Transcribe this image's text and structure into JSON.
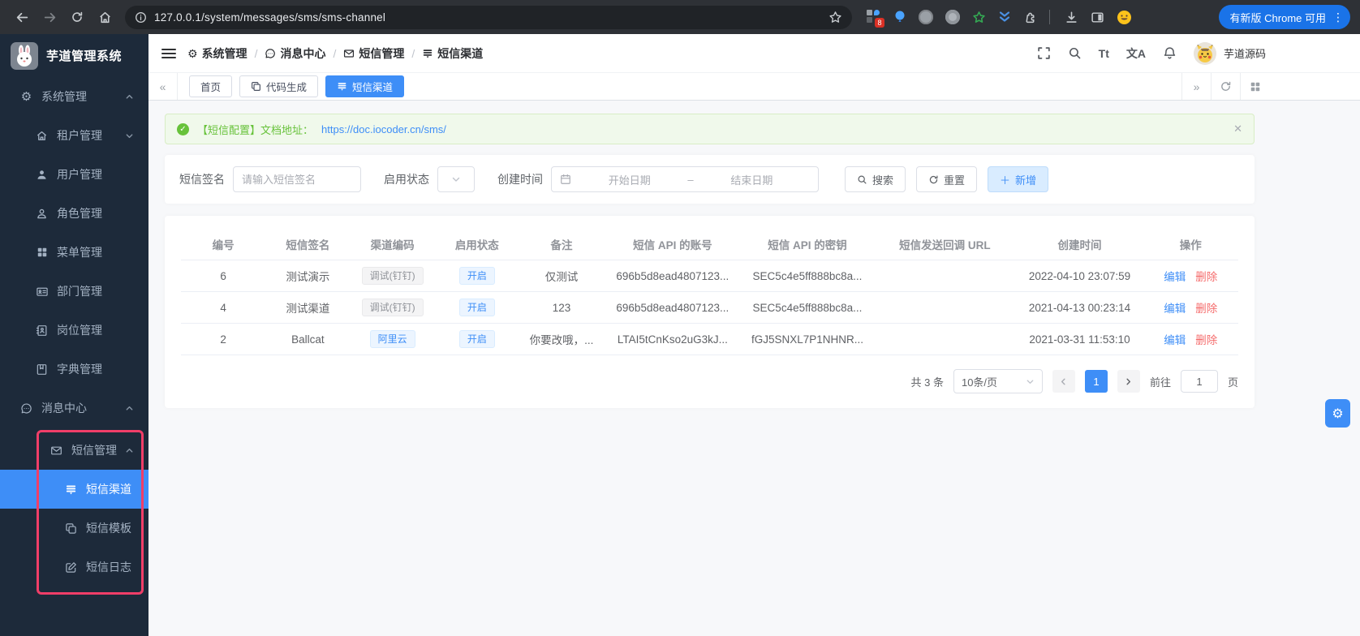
{
  "colors": {
    "accent": "#3e8ef7",
    "sidebar_bg": "#1d2a3a",
    "highlight_box": "#f03e68",
    "success": "#67c23a",
    "danger": "#f56c6c",
    "chrome_update_pill": "#1a73e8"
  },
  "icons": {
    "gear": "⚙",
    "collapse_tabs": "«",
    "expand_tabs": "»",
    "close": "✕",
    "plus": "＋",
    "kebab": "⋮",
    "font_size": "Tt",
    "language": "文A"
  },
  "browser": {
    "url": "127.0.0.1/system/messages/sms/sms-channel",
    "update_button": "有新版 Chrome 可用",
    "extension_badge": "8"
  },
  "app_title": "芋道管理系统",
  "topbar": {
    "breadcrumb": [
      {
        "label": "系统管理"
      },
      {
        "label": "消息中心"
      },
      {
        "label": "短信管理"
      },
      {
        "label": "短信渠道"
      }
    ],
    "username": "芋道源码"
  },
  "tabs": {
    "items": [
      {
        "label": "首页"
      },
      {
        "label": "代码生成"
      },
      {
        "label": "短信渠道"
      }
    ]
  },
  "sidebar": {
    "items": [
      {
        "label": "系统管理"
      },
      {
        "label": "租户管理"
      },
      {
        "label": "用户管理"
      },
      {
        "label": "角色管理"
      },
      {
        "label": "菜单管理"
      },
      {
        "label": "部门管理"
      },
      {
        "label": "岗位管理"
      },
      {
        "label": "字典管理"
      },
      {
        "label": "消息中心"
      },
      {
        "label": "短信管理"
      },
      {
        "label": "短信渠道"
      },
      {
        "label": "短信模板"
      },
      {
        "label": "短信日志"
      }
    ]
  },
  "alert": {
    "text": "【短信配置】文档地址：",
    "link": "https://doc.iocoder.cn/sms/"
  },
  "filters": {
    "signature_label": "短信签名",
    "signature_placeholder": "请输入短信签名",
    "status_label": "启用状态",
    "date_label": "创建时间",
    "start_placeholder": "开始日期",
    "range_separator": "–",
    "end_placeholder": "结束日期",
    "search_button": "搜索",
    "reset_button": "重置",
    "add_button": "新增"
  },
  "table": {
    "columns": [
      "编号",
      "短信签名",
      "渠道编码",
      "启用状态",
      "备注",
      "短信 API 的账号",
      "短信 API 的密钥",
      "短信发送回调 URL",
      "创建时间",
      "操作"
    ],
    "rows": [
      {
        "id": "6",
        "signature": "测试演示",
        "channel": "调试(钉钉)",
        "status": "开启",
        "remark": "仅测试",
        "api_account": "696b5d8ead4807123...",
        "api_secret": "SEC5c4e5ff888bc8a...",
        "callback_url": "",
        "created": "2022-04-10 23:07:59"
      },
      {
        "id": "4",
        "signature": "测试渠道",
        "channel": "调试(钉钉)",
        "status": "开启",
        "remark": "123",
        "api_account": "696b5d8ead4807123...",
        "api_secret": "SEC5c4e5ff888bc8a...",
        "callback_url": "",
        "created": "2021-04-13 00:23:14"
      },
      {
        "id": "2",
        "signature": "Ballcat",
        "channel": "阿里云",
        "status": "开启",
        "remark": "你要改哦，...",
        "api_account": "LTAI5tCnKso2uG3kJ...",
        "api_secret": "fGJ5SNXL7P1NHNR...",
        "callback_url": "",
        "created": "2021-03-31 11:53:10"
      }
    ],
    "actions": {
      "edit": "编辑",
      "delete": "删除"
    }
  },
  "pagination": {
    "total": "共 3 条",
    "page_size": "10条/页",
    "current_page": "1",
    "goto_label": "前往",
    "goto_value": "1",
    "page_unit": "页"
  }
}
